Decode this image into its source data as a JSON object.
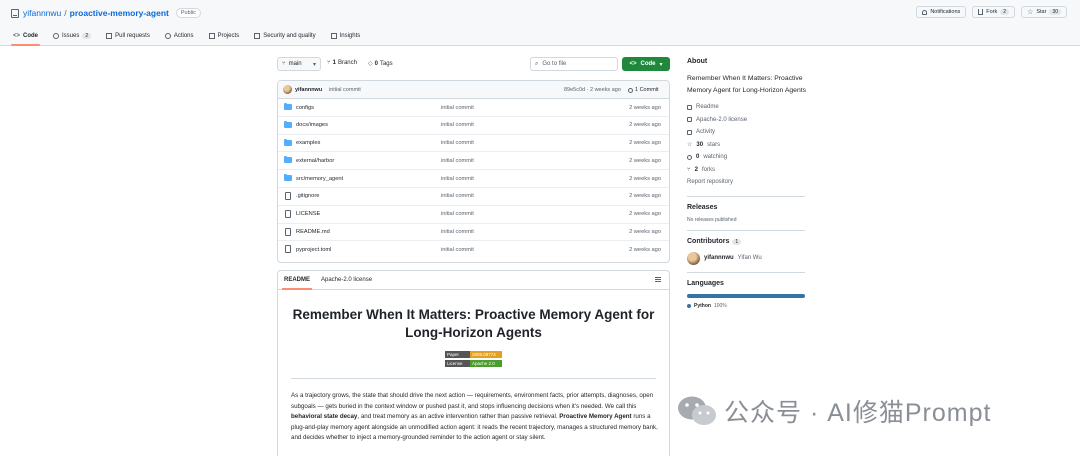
{
  "header": {
    "owner": "yifannnwu",
    "separator": "/",
    "repo": "proactive-memory-agent",
    "visibility": "Public",
    "notifications": "Notifications",
    "fork_label": "Fork",
    "fork_count": "2",
    "star_label": "Star",
    "star_count": "30"
  },
  "tabs": [
    {
      "label": "Code",
      "count": ""
    },
    {
      "label": "Issues",
      "count": "2"
    },
    {
      "label": "Pull requests",
      "count": ""
    },
    {
      "label": "Actions",
      "count": ""
    },
    {
      "label": "Projects",
      "count": ""
    },
    {
      "label": "Security and quality",
      "count": ""
    },
    {
      "label": "Insights",
      "count": ""
    }
  ],
  "toolbar": {
    "branch": "main",
    "branches_count": "1",
    "branches_label": "Branch",
    "tags_count": "0",
    "tags_label": "Tags",
    "goto_placeholder": "Go to file",
    "code_button": "Code"
  },
  "commit": {
    "author": "yifannnwu",
    "message": "initial commit",
    "sha_time": "89e5c0d · 2 weeks ago",
    "count": "1 Commit"
  },
  "files": [
    {
      "name": "configs",
      "type": "dir",
      "message": "initial commit",
      "age": "2 weeks ago"
    },
    {
      "name": "docs/images",
      "type": "dir",
      "message": "initial commit",
      "age": "2 weeks ago"
    },
    {
      "name": "examples",
      "type": "dir",
      "message": "initial commit",
      "age": "2 weeks ago"
    },
    {
      "name": "external/harbor",
      "type": "dir",
      "message": "initial commit",
      "age": "2 weeks ago"
    },
    {
      "name": "src/memory_agent",
      "type": "dir",
      "message": "initial commit",
      "age": "2 weeks ago"
    },
    {
      "name": ".gitignore",
      "type": "file",
      "message": "initial commit",
      "age": "2 weeks ago"
    },
    {
      "name": "LICENSE",
      "type": "file",
      "message": "initial commit",
      "age": "2 weeks ago"
    },
    {
      "name": "README.md",
      "type": "file",
      "message": "initial commit",
      "age": "2 weeks ago"
    },
    {
      "name": "pyproject.toml",
      "type": "file",
      "message": "initial commit",
      "age": "2 weeks ago"
    }
  ],
  "readme": {
    "tab_readme": "README",
    "tab_license": "Apache-2.0 license",
    "title": "Remember When It Matters: Proactive Memory Agent for Long-Horizon Agents",
    "badge_paper_label": "Paper",
    "badge_paper_value": "2605.08774",
    "badge_license_label": "License",
    "badge_license_value": "Apache 2.0",
    "p1": "As a trajectory grows, the state that should drive the next action — requirements, environment facts, prior attempts, diagnoses, open subgoals — gets buried in the context window or pushed past it, and stops influencing decisions when it's needed. We call this ",
    "p1_bold": "behavioral state decay",
    "p2": ", and treat memory as an active intervention rather than passive retrieval. ",
    "p2_bold": "Proactive Memory Agent",
    "p3": " runs a plug-and-play memory agent alongside an unmodified action agent: it reads the recent trajectory, manages a structured memory bank, and decides whether to inject a memory-grounded reminder to the action agent or stay silent."
  },
  "sidebar": {
    "about_heading": "About",
    "description": "Remember When It Matters: Proactive Memory Agent for Long-Horizon Agents",
    "readme": "Readme",
    "license": "Apache-2.0 license",
    "activity": "Activity",
    "stars_count": "30",
    "stars_label": "stars",
    "watching_count": "0",
    "watching_label": "watching",
    "forks_count": "2",
    "forks_label": "forks",
    "report": "Report repository",
    "releases_heading": "Releases",
    "no_releases": "No releases published",
    "contributors_heading": "Contributors",
    "contributors_count": "1",
    "contributor_login": "yifannnwu",
    "contributor_name": "Yifan Wu",
    "languages_heading": "Languages",
    "language": "Python",
    "language_pct": "100%"
  },
  "watermark": "公众号 · AI修猫Prompt",
  "colors": {
    "accent_green": "#1f883d",
    "link_blue": "#0969da",
    "tab_underline": "#fd8c73",
    "python": "#3572a5",
    "folder": "#54aeff"
  }
}
